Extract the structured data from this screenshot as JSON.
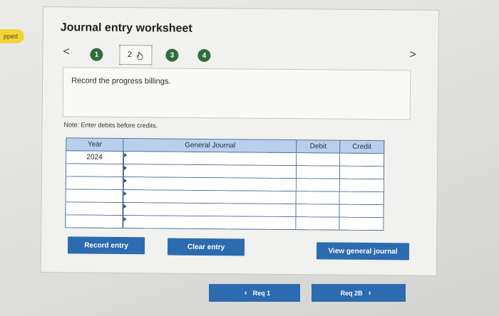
{
  "left_tab": {
    "label": "pped"
  },
  "worksheet": {
    "title": "Journal entry worksheet",
    "prev": "<",
    "next": ">",
    "steps": [
      {
        "label": "1",
        "state": "complete"
      },
      {
        "label": "2",
        "state": "current"
      },
      {
        "label": "3",
        "state": "complete"
      },
      {
        "label": "4",
        "state": "complete"
      }
    ],
    "instruction": "Record the progress billings.",
    "note": "Note: Enter debits before credits."
  },
  "table": {
    "headers": [
      "Year",
      "General Journal",
      "Debit",
      "Credit"
    ],
    "rows": [
      {
        "year": "2024",
        "account": "",
        "debit": "",
        "credit": ""
      },
      {
        "year": "",
        "account": "",
        "debit": "",
        "credit": ""
      },
      {
        "year": "",
        "account": "",
        "debit": "",
        "credit": ""
      },
      {
        "year": "",
        "account": "",
        "debit": "",
        "credit": ""
      },
      {
        "year": "",
        "account": "",
        "debit": "",
        "credit": ""
      },
      {
        "year": "",
        "account": "",
        "debit": "",
        "credit": ""
      }
    ]
  },
  "buttons": {
    "record_entry": "Record entry",
    "clear_entry": "Clear entry",
    "view_general_journal": "View general journal"
  },
  "footer_nav": {
    "prev_label": "Req 1",
    "next_label": "Req 2B"
  },
  "colors": {
    "accent": "#2c6bb0",
    "step_complete": "#2f6e3c",
    "table_header": "#b9d0ec"
  }
}
